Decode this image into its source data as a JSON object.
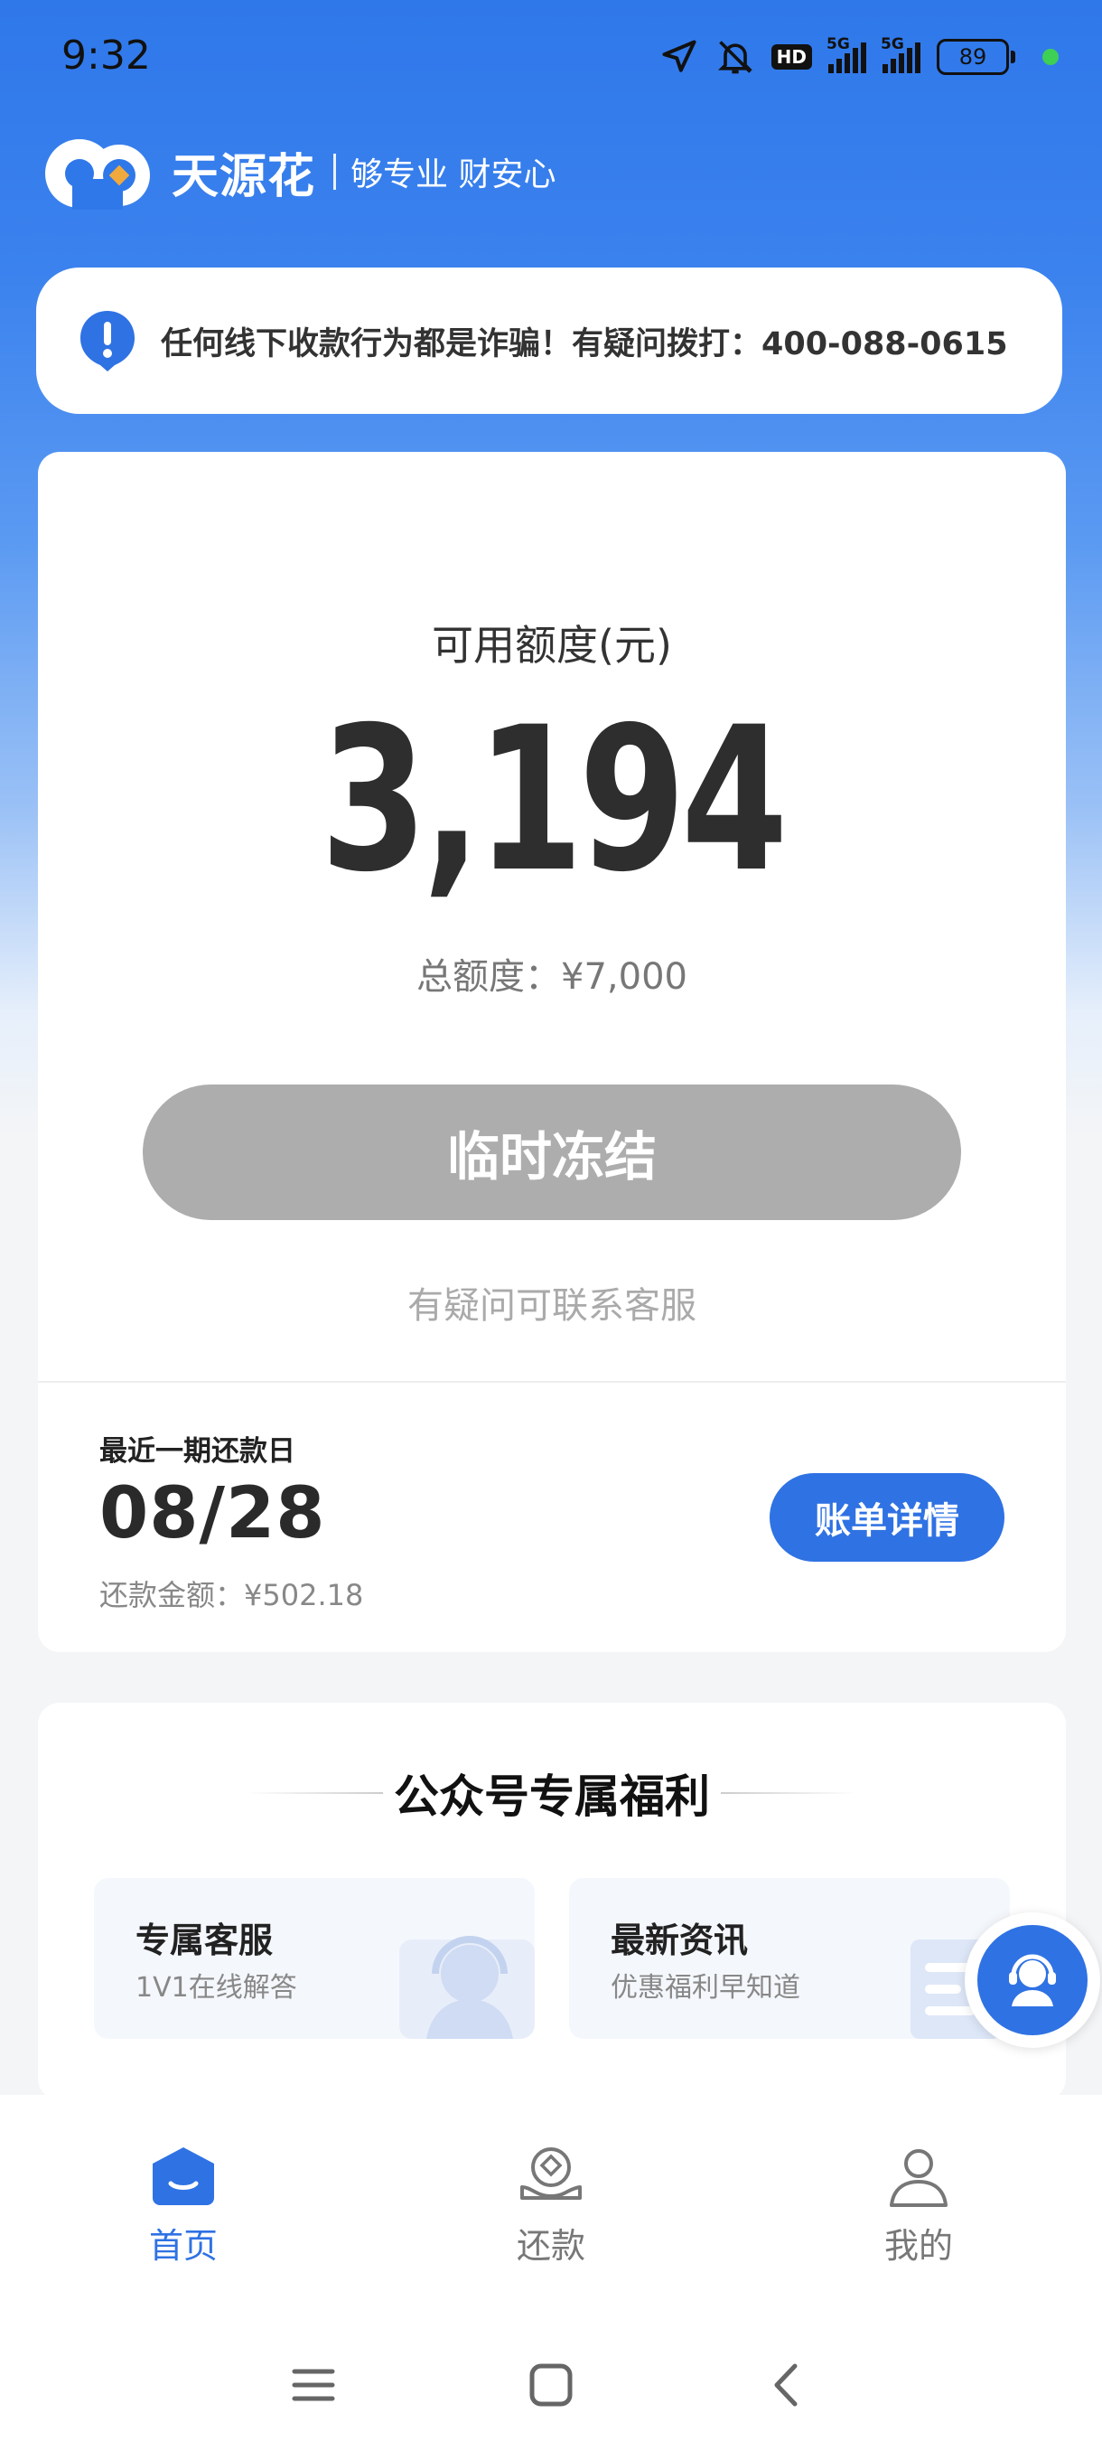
{
  "status_bar": {
    "time": "9:32",
    "hd_label": "HD",
    "sim1_label": "5G",
    "sim2_label": "5G",
    "battery": "89"
  },
  "brand": {
    "name": "天源花",
    "slogan": "够专业 财安心"
  },
  "notice": {
    "text": "任何线下收款行为都是诈骗！有疑问拨打：400-088-0615"
  },
  "credit": {
    "label": "可用额度(元)",
    "amount": "3,194",
    "total": "总额度：¥7,000",
    "status_button": "临时冻结",
    "contact_tip": "有疑问可联系客服"
  },
  "repayment": {
    "label": "最近一期还款日",
    "date": "08/28",
    "amount": "还款金额：¥502.18",
    "detail_button": "账单详情"
  },
  "benefits": {
    "title": "公众号专属福利",
    "items": [
      {
        "title": "专属客服",
        "subtitle": "1V1在线解答"
      },
      {
        "title": "最新资讯",
        "subtitle": "优惠福利早知道"
      }
    ]
  },
  "tabs": [
    {
      "label": "首页",
      "icon": "home-icon",
      "active": true
    },
    {
      "label": "还款",
      "icon": "repay-icon",
      "active": false
    },
    {
      "label": "我的",
      "icon": "profile-icon",
      "active": false
    }
  ],
  "colors": {
    "primary": "#2f72e3",
    "disabled": "#adadad",
    "header_gradient_top": "#2f78ea"
  }
}
